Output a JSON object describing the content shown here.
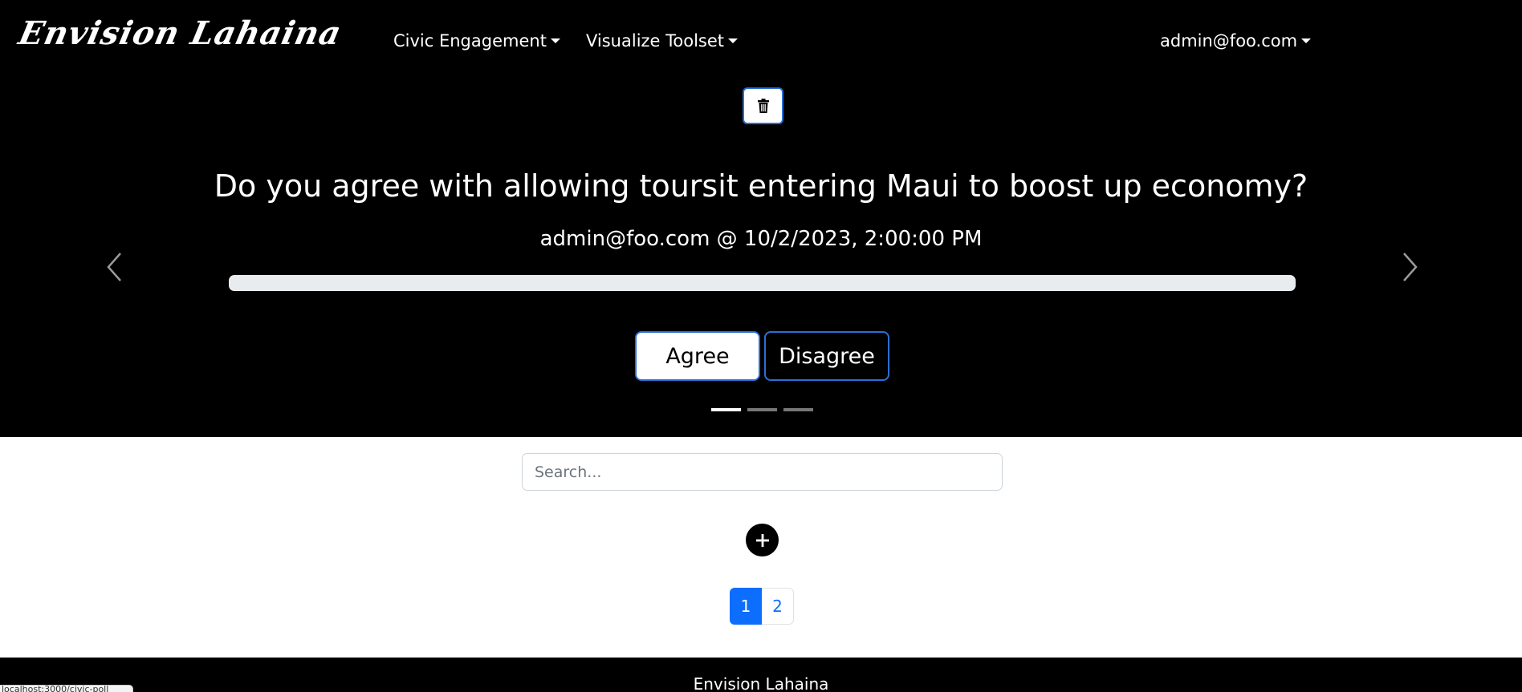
{
  "navbar": {
    "brand": "Envision Lahaina",
    "menus": [
      {
        "label": "Civic Engagement"
      },
      {
        "label": "Visualize Toolset"
      }
    ],
    "user": "admin@foo.com"
  },
  "carousel": {
    "question": "Do you agree with allowing toursit entering Maui to boost up economy?",
    "meta": "admin@foo.com @ 10/2/2023, 2:00:00 PM",
    "progress_fraction": 0,
    "agree_label": "Agree",
    "disagree_label": "Disagree",
    "slide_count": 3,
    "active_slide": 1
  },
  "search": {
    "placeholder": "Search..."
  },
  "pagination": {
    "pages": [
      "1",
      "2"
    ],
    "active": "1"
  },
  "footer": {
    "text": "Envision Lahaina"
  },
  "status_bar": {
    "url": "localhost:3000/civic-poll"
  },
  "colors": {
    "navbar_bg": "#000000",
    "accent": "#0d6efd",
    "button_border": "#2b6fd6",
    "progress_track": "#e9ecef"
  },
  "icons": [
    "trash-icon",
    "chevron-left-icon",
    "chevron-right-icon",
    "plus-icon",
    "caret-down-icon"
  ]
}
